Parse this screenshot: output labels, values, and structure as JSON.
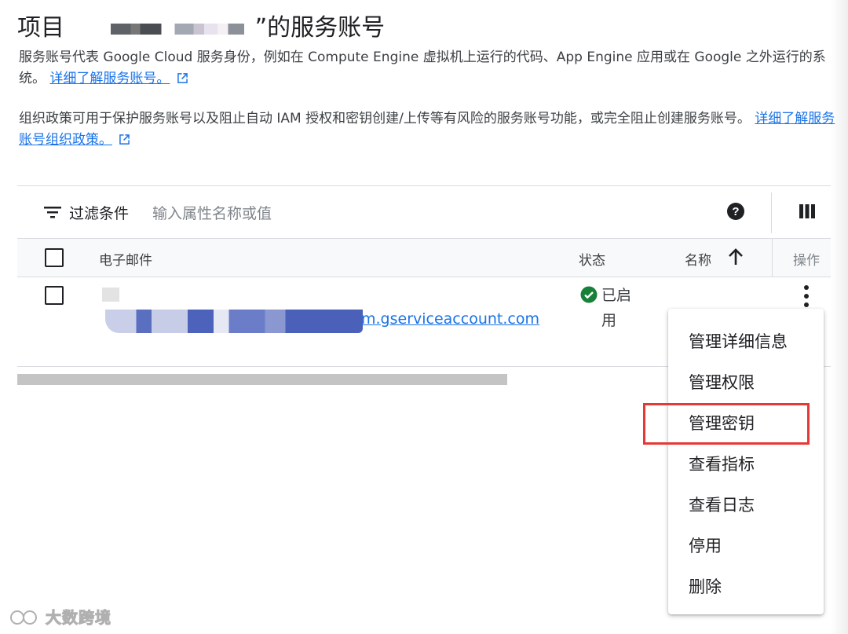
{
  "header": {
    "title_prefix": "项目",
    "title_suffix": "”的服务账号"
  },
  "description": {
    "p1_text": "服务账号代表 Google Cloud 服务身份，例如在 Compute Engine 虚拟机上运行的代码、App Engine 应用或在 Google 之外运行的系统。",
    "p1_link": "详细了解服务账号。",
    "p2_text": "组织政策可用于保护服务账号以及阻止自动 IAM 授权和密钥创建/上传等有风险的服务账号功能，或完全阻止创建服务账号。",
    "p2_link": "详细了解服务账号组织政策。"
  },
  "filter": {
    "label": "过滤条件",
    "placeholder": "输入属性名称或值"
  },
  "table": {
    "headers": {
      "email": "电子邮件",
      "status": "状态",
      "name": "名称",
      "actions": "操作"
    },
    "rows": [
      {
        "email_visible": "m.gserviceaccount.com",
        "status": "已启用"
      }
    ]
  },
  "menu": {
    "items": [
      {
        "label": "管理详细信息"
      },
      {
        "label": "管理权限"
      },
      {
        "label": "管理密钥"
      },
      {
        "label": "查看指标"
      },
      {
        "label": "查看日志"
      },
      {
        "label": "停用"
      },
      {
        "label": "删除"
      }
    ]
  },
  "watermark": "大数跨境",
  "colors": {
    "link": "#1a73e8",
    "status_ok": "#188038",
    "highlight": "#e53935"
  }
}
